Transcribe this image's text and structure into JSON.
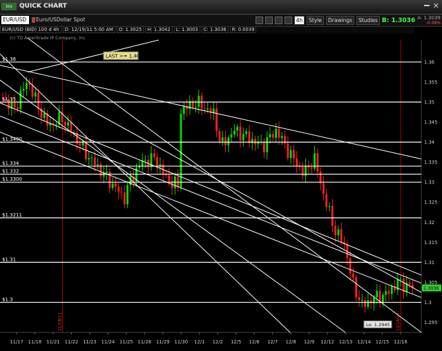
{
  "window": {
    "app_logo": "tos",
    "title": "QUICK CHART"
  },
  "toolbar": {
    "symbol": "EUR/USD",
    "symbol_desc": "Euro/USDollar Spot",
    "timeframe": "4h",
    "style_label": "Style",
    "drawings_label": "Drawings",
    "studies_label": "Studies",
    "bid": "B: 1.3036",
    "ask": "A: 1.3039",
    "pct": "-0.08%"
  },
  "infobar": {
    "symbol": "EUR/USD (BID) 100 d 4h",
    "datetime": "D: 12/19/11 5:00 AM",
    "open": "O: 1.3025",
    "high": "H: 1.3042",
    "low": "L: 1.3003",
    "close": "C: 1.3036",
    "range": "R: 0.0039"
  },
  "copyright": "(c) TD Ameritrade IP Company, Inc.",
  "alert_label": "LAST >= 1.40",
  "lo_label": "Lo: 1.2945",
  "last_price_label": "1.3036",
  "colors": {
    "up": "#00e000",
    "down": "#ff2020",
    "level": "#ffffff",
    "background": "#000000",
    "session": "#b00000"
  },
  "chart_data": {
    "type": "candlestick",
    "title": "EUR/USD (BID) 100 d 4h",
    "ylim": [
      1.2925,
      1.3655
    ],
    "y_ticks": [
      "1.36",
      "1.355",
      "1.35",
      "1.345",
      "1.34",
      "1.335",
      "1.33",
      "1.325",
      "1.32",
      "1.315",
      "1.31",
      "1.305",
      "1.3",
      "1.295"
    ],
    "x_ticks": [
      "11/17",
      "11/18",
      "11/21",
      "11/22",
      "11/23",
      "11/24",
      "11/25",
      "11/28",
      "11/29",
      "11/30",
      "12/1",
      "12/2",
      "12/5",
      "12/6",
      "12/7",
      "12/8",
      "12/9",
      "12/12",
      "12/13",
      "12/14",
      "12/15",
      "12/16"
    ],
    "session_markers": [
      "11/18/11",
      "12/16/11"
    ],
    "horizontal_levels": [
      {
        "label": "$1.36",
        "value": 1.36
      },
      {
        "label": "$1.35",
        "value": 1.35
      },
      {
        "label": "$1.3400",
        "value": 1.34
      },
      {
        "label": "$1.334",
        "value": 1.334
      },
      {
        "label": "$1.332",
        "value": 1.332
      },
      {
        "label": "$1.3300",
        "value": 1.33
      },
      {
        "label": "$1.3211",
        "value": 1.3211
      },
      {
        "label": "$1.31",
        "value": 1.31
      },
      {
        "label": "$1.3",
        "value": 1.3
      }
    ],
    "last_price": 1.3036,
    "low_value": 1.2945
  }
}
